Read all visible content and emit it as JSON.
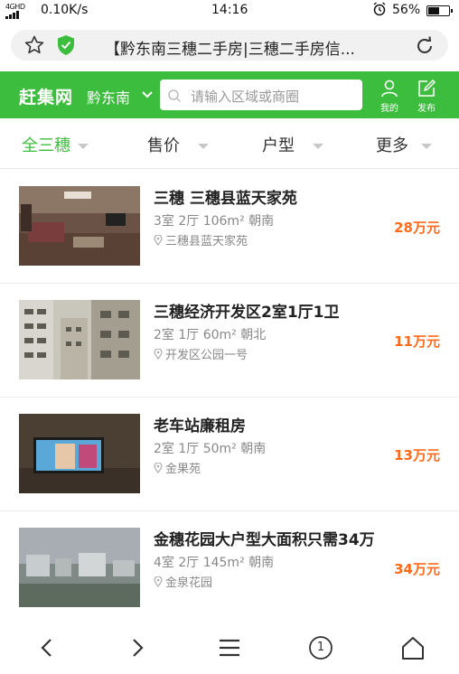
{
  "status_bar": {
    "network_type": "4G",
    "signal_sub": "HD",
    "speed": "0.10K/s",
    "time": "14:16",
    "battery": "56%",
    "battery_level": 0.56
  },
  "browser": {
    "page_title": "【黔东南三穗二手房|三穗二手房信..."
  },
  "header": {
    "logo": "赶集网",
    "city": "黔东南",
    "search_placeholder": "请输入区域或商圈",
    "mine_label": "我的",
    "publish_label": "发布",
    "brand_color": "#3dbd3d"
  },
  "filters": [
    {
      "label": "全三穗",
      "active": true
    },
    {
      "label": "售价",
      "active": false
    },
    {
      "label": "户型",
      "active": false
    },
    {
      "label": "更多",
      "active": false
    }
  ],
  "listings": [
    {
      "title": "三穗 三穗县蓝天家苑",
      "specs": "3室 2厅 106m² 朝南",
      "location": "三穗县蓝天家苑",
      "price": "28万元",
      "image": "living-room-photo"
    },
    {
      "title": "三穗经济开发区2室1厅1卫",
      "specs": "2室 1厅 60m² 朝北",
      "location": "开发区公园一号",
      "price": "11万元",
      "image": "apartment-buildings-photo"
    },
    {
      "title": "老车站廉租房",
      "specs": "2室 1厅 50m² 朝南",
      "location": "金果苑",
      "price": "13万元",
      "image": "tv-room-photo"
    },
    {
      "title": "金穗花园大户型大面积只需34万",
      "specs": "4室 2厅 145m² 朝南",
      "location": "金泉花园",
      "price": "34万元",
      "image": "city-view-photo"
    }
  ],
  "price_color": "#ff6a1a",
  "bottom_nav": {
    "tab_count": "1"
  }
}
